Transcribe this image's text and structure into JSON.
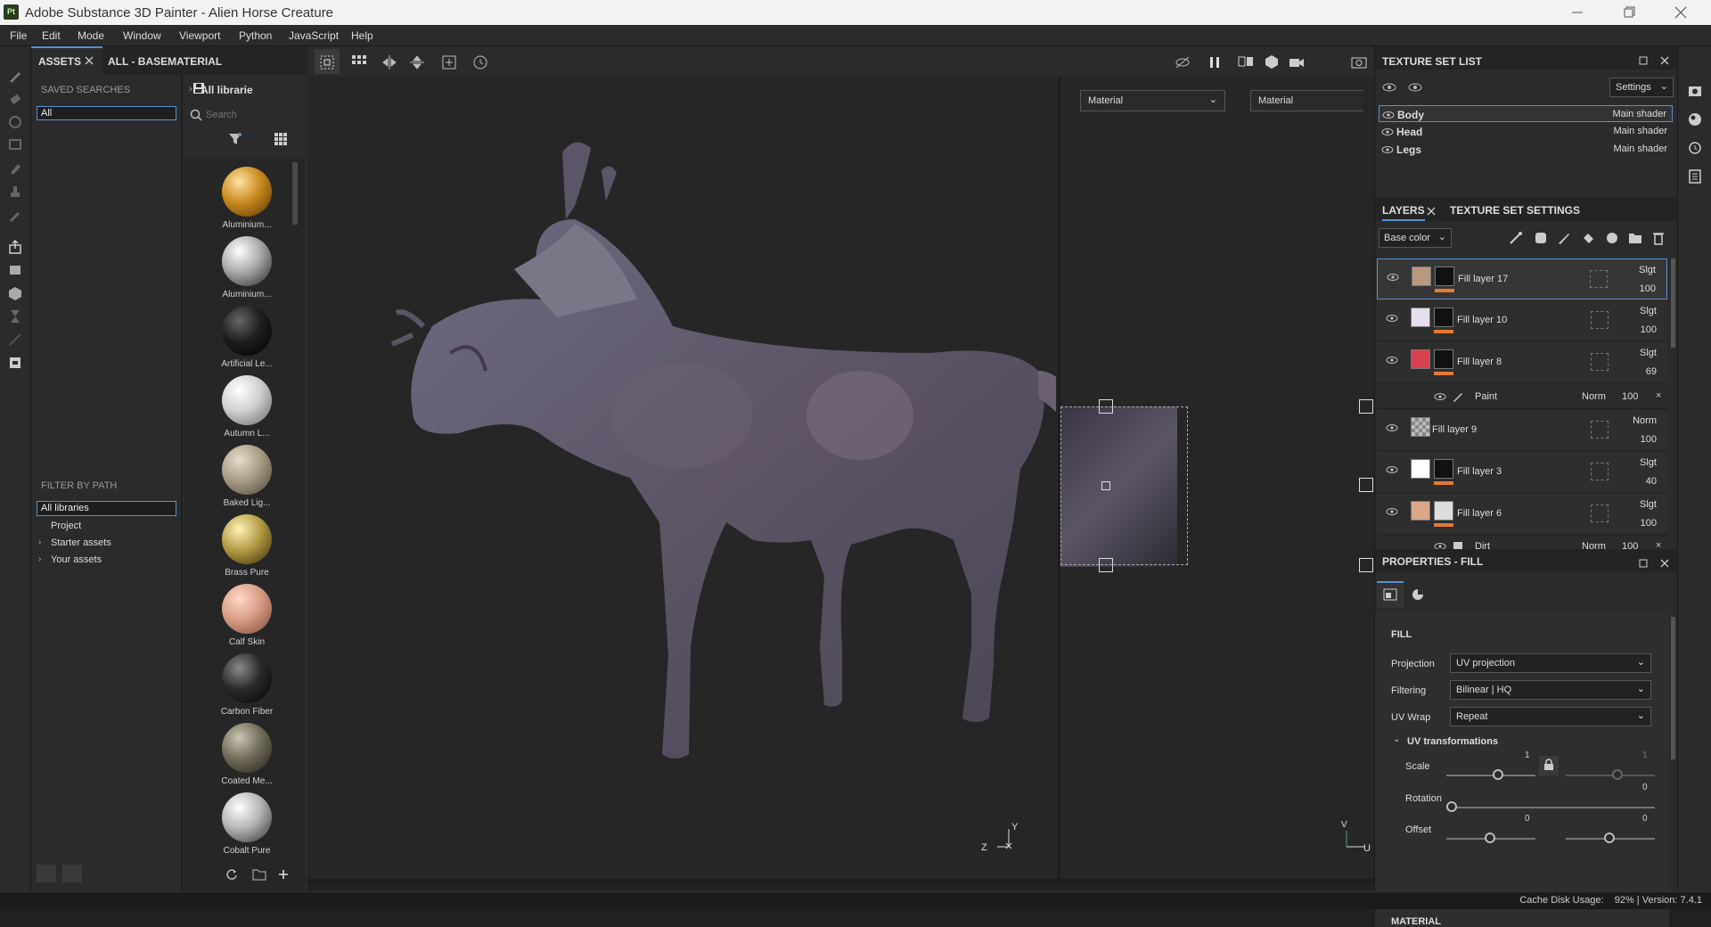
{
  "window": {
    "title": "Adobe Substance 3D Painter - Alien Horse Creature",
    "logo": "Pt"
  },
  "menu": [
    "File",
    "Edit",
    "Mode",
    "Window",
    "Viewport",
    "Python",
    "JavaScript",
    "Help"
  ],
  "assets": {
    "tab1": "ASSETS",
    "tab2": "ALL - BASEMATERIAL",
    "saved_searches": "SAVED SEARCHES",
    "saved_value": "All",
    "breadcrumb": "All librarie",
    "search_placeholder": "Search",
    "filter_by_path": "FILTER BY PATH",
    "paths": [
      "All libraries",
      "Project",
      "Starter assets",
      "Your assets"
    ],
    "materials": [
      {
        "label": "Aluminium...",
        "color": "radial-gradient(circle at 35% 30%,#ffe2a0,#c98a1e 45%,#6a4208 90%)"
      },
      {
        "label": "Aluminium...",
        "color": "radial-gradient(circle at 35% 30%,#ffffff,#a9a9a9 45%,#3a3a3a 90%)"
      },
      {
        "label": "Artificial Le...",
        "color": "radial-gradient(circle at 35% 30%,#666,#1e1e1e 45%,#050505 90%)"
      },
      {
        "label": "Autumn L...",
        "color": "radial-gradient(circle at 35% 30%,#ffffff,#cfcfcf 45%,#777 90%)"
      },
      {
        "label": "Baked Lig...",
        "color": "radial-gradient(circle at 35% 30%,#e6dccb,#a89c86 45%,#5b5344 90%)"
      },
      {
        "label": "Brass Pure",
        "color": "radial-gradient(circle at 35% 30%,#fff3b8,#b49b45 45%,#4c3f10 90%)"
      },
      {
        "label": "Calf Skin",
        "color": "radial-gradient(circle at 35% 30%,#ffd8c8,#d79d85 45%,#8a5845 90%)"
      },
      {
        "label": "Carbon Fiber",
        "color": "radial-gradient(circle at 35% 30%,#8a8a8a,#2a2a2a 45%,#0a0a0a 90%)"
      },
      {
        "label": "Coated Me...",
        "color": "radial-gradient(circle at 35% 30%,#c9c5b0,#716d5a 45%,#2f2d24 90%)"
      },
      {
        "label": "Cobalt Pure",
        "color": "radial-gradient(circle at 35% 30%,#ffffff,#b5b5b5 45%,#444 90%)"
      }
    ]
  },
  "viewport": {
    "dropdown_left": "Material",
    "dropdown_right": "Material",
    "axis_left": [
      "Y",
      "Z",
      "X"
    ],
    "axis_right": [
      "V",
      "U"
    ]
  },
  "texture_set_list": {
    "title": "TEXTURE SET LIST",
    "settings": "Settings",
    "sets": [
      {
        "name": "Body",
        "shader": "Main shader"
      },
      {
        "name": "Head",
        "shader": "Main shader"
      },
      {
        "name": "Legs",
        "shader": "Main shader"
      }
    ]
  },
  "layers": {
    "tab1": "LAYERS",
    "tab2": "TEXTURE SET SETTINGS",
    "channel": "Base color",
    "items": [
      {
        "name": "Fill layer 17",
        "blend": "Slgt",
        "opacity": "100",
        "thumb": "#b89a80"
      },
      {
        "name": "Fill layer 10",
        "blend": "Slgt",
        "opacity": "100",
        "thumb": "#e6dff0"
      },
      {
        "name": "Fill layer 8",
        "blend": "Slgt",
        "opacity": "69",
        "thumb": "#d6434f"
      },
      {
        "name": "Fill layer 9",
        "blend": "Norm",
        "opacity": "100",
        "thumb": "#888"
      },
      {
        "name": "Fill layer 3",
        "blend": "Slgt",
        "opacity": "40",
        "thumb": "#ffffff"
      },
      {
        "name": "Fill layer 6",
        "blend": "Slgt",
        "opacity": "100",
        "thumb": "#d9a789"
      }
    ],
    "sub_paint": {
      "name": "Paint",
      "blend": "Norm",
      "opacity": "100"
    },
    "sub_dirt": {
      "name": "Dirt",
      "blend": "Norm",
      "opacity": "100"
    }
  },
  "properties": {
    "title": "PROPERTIES - FILL",
    "fill": "FILL",
    "projection_label": "Projection",
    "projection": "UV projection",
    "filtering_label": "Filtering",
    "filtering": "Bilinear | HQ",
    "uvwrap_label": "UV Wrap",
    "uvwrap": "Repeat",
    "uvtrans": "UV transformations",
    "scale_label": "Scale",
    "scale": "1",
    "scale2": "1",
    "rotation_label": "Rotation",
    "rotation": "0",
    "offset_label": "Offset",
    "offset1": "0",
    "offset2": "0",
    "material": "MATERIAL"
  },
  "status": {
    "text": "Cache Disk Usage:    92% | Version: 7.4.1"
  }
}
